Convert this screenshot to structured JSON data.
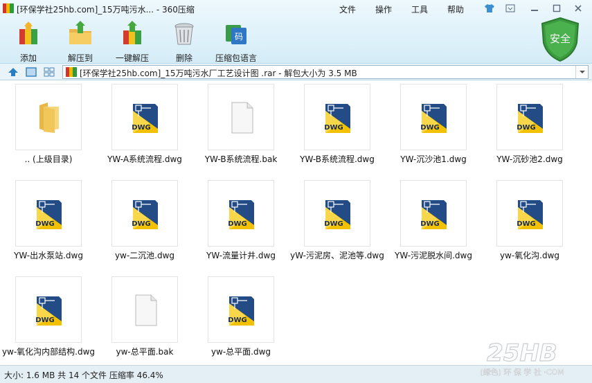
{
  "window": {
    "title": "[环保学社25hb.com]_15万吨污水... - 360压缩"
  },
  "menu": [
    "文件",
    "操作",
    "工具",
    "帮助"
  ],
  "toolbar": [
    {
      "label": "添加",
      "icon": "add-archive-icon"
    },
    {
      "label": "解压到",
      "icon": "extract-to-icon"
    },
    {
      "label": "一键解压",
      "icon": "one-click-extract-icon"
    },
    {
      "label": "删除",
      "icon": "trash-icon"
    },
    {
      "label": "压缩包语言",
      "icon": "archive-language-icon"
    }
  ],
  "shield": {
    "label": "安全"
  },
  "addressbar": {
    "path": "[环保学社25hb.com]_15万吨污水厂工艺设计图 .rar - 解包大小为 3.5 MB"
  },
  "files": [
    {
      "name": ".. (上级目录)",
      "type": "folder"
    },
    {
      "name": "YW-A系统流程.dwg",
      "type": "dwg"
    },
    {
      "name": "YW-B系统流程.bak",
      "type": "bak"
    },
    {
      "name": "YW-B系统流程.dwg",
      "type": "dwg"
    },
    {
      "name": "YW-沉沙池1.dwg",
      "type": "dwg"
    },
    {
      "name": "YW-沉砂池2.dwg",
      "type": "dwg"
    },
    {
      "name": "YW-出水泵站.dwg",
      "type": "dwg"
    },
    {
      "name": "yw-二沉池.dwg",
      "type": "dwg"
    },
    {
      "name": "YW-流量计井.dwg",
      "type": "dwg"
    },
    {
      "name": "yW-污泥房、泥池等.dwg",
      "type": "dwg"
    },
    {
      "name": "YW-污泥脱水间.dwg",
      "type": "dwg"
    },
    {
      "name": "yw-氧化沟.dwg",
      "type": "dwg"
    },
    {
      "name": "yw-氧化沟内部结构.dwg",
      "type": "dwg"
    },
    {
      "name": "yw-总平面.bak",
      "type": "bak"
    },
    {
      "name": "yw-总平面.dwg",
      "type": "dwg"
    }
  ],
  "dwg_badge": "DWG",
  "status": {
    "text": "大小: 1.6 MB 共 14 个文件 压缩率 46.4%"
  },
  "watermark": {
    "logo": "25HB",
    "tagline": "(绿色) 环 保 学 社 ·COM"
  },
  "colors": {
    "accent": "#2a7fc1",
    "shield": "#3b9a3e",
    "dwg_yellow": "#f2c200",
    "dwg_blue": "#234c86"
  }
}
